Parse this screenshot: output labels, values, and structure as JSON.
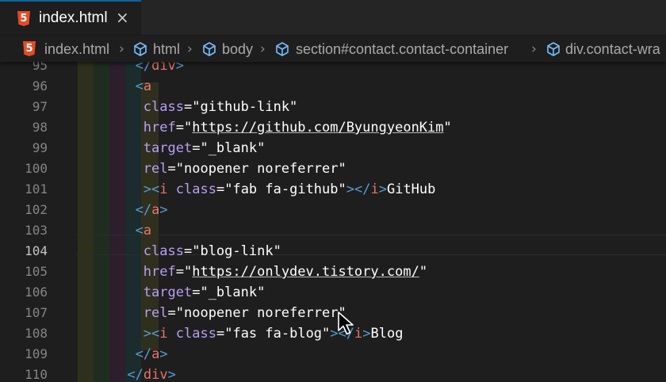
{
  "tab": {
    "label": "index.html",
    "close": "×",
    "icon": "html5-icon"
  },
  "breadcrumb": [
    {
      "label": "index.html",
      "icon": "html5-icon"
    },
    {
      "label": "html",
      "icon": "cube-icon"
    },
    {
      "label": "body",
      "icon": "cube-icon"
    },
    {
      "label": "section#contact.contact-container",
      "icon": "cube-icon"
    },
    {
      "label": "div.contact-wra",
      "icon": "cube-icon"
    }
  ],
  "editor": {
    "active_line": "104",
    "lines": [
      {
        "num": "95",
        "indent": "      ",
        "tokens": [
          [
            "tag",
            "</"
          ],
          [
            "tname",
            "div"
          ],
          [
            "tag",
            ">"
          ]
        ]
      },
      {
        "num": "96",
        "indent": "      ",
        "tokens": [
          [
            "tag",
            "<"
          ],
          [
            "tname",
            "a"
          ]
        ]
      },
      {
        "num": "97",
        "indent": "        ",
        "tokens": [
          [
            "attr",
            "class"
          ],
          [
            "str",
            "="
          ],
          [
            "str",
            "\"github-link\""
          ]
        ]
      },
      {
        "num": "98",
        "indent": "        ",
        "tokens": [
          [
            "attr",
            "href"
          ],
          [
            "str",
            "=\""
          ],
          [
            "link",
            "https://github.com/ByungyeonKim"
          ],
          [
            "str",
            "\""
          ]
        ]
      },
      {
        "num": "99",
        "indent": "        ",
        "tokens": [
          [
            "attr",
            "target"
          ],
          [
            "str",
            "=\"_blank\""
          ]
        ]
      },
      {
        "num": "100",
        "indent": "        ",
        "tokens": [
          [
            "attr",
            "rel"
          ],
          [
            "str",
            "=\"noopener noreferrer\""
          ]
        ]
      },
      {
        "num": "101",
        "indent": "        ",
        "tokens": [
          [
            "tag",
            ">"
          ],
          [
            "tag",
            "<"
          ],
          [
            "tname",
            "i"
          ],
          [
            "plain",
            " "
          ],
          [
            "attr",
            "class"
          ],
          [
            "str",
            "=\"fab fa-github\""
          ],
          [
            "tag",
            "></"
          ],
          [
            "tname",
            "i"
          ],
          [
            "tag",
            ">"
          ],
          [
            "str",
            "GitHub"
          ]
        ]
      },
      {
        "num": "102",
        "indent": "      ",
        "tokens": [
          [
            "tag",
            "</"
          ],
          [
            "tname",
            "a"
          ],
          [
            "tag",
            ">"
          ]
        ]
      },
      {
        "num": "103",
        "indent": "      ",
        "tokens": [
          [
            "tag",
            "<"
          ],
          [
            "tname",
            "a"
          ]
        ]
      },
      {
        "num": "104",
        "indent": "        ",
        "tokens": [
          [
            "attr",
            "class"
          ],
          [
            "str",
            "=\"blog-link\""
          ]
        ]
      },
      {
        "num": "105",
        "indent": "        ",
        "tokens": [
          [
            "attr",
            "href"
          ],
          [
            "str",
            "=\""
          ],
          [
            "link",
            "https://onlydev.tistory.com/"
          ],
          [
            "str",
            "\""
          ]
        ]
      },
      {
        "num": "106",
        "indent": "        ",
        "tokens": [
          [
            "attr",
            "target"
          ],
          [
            "str",
            "=\"_blank\""
          ]
        ]
      },
      {
        "num": "107",
        "indent": "        ",
        "tokens": [
          [
            "attr",
            "rel"
          ],
          [
            "str",
            "=\"noopener noreferrer\""
          ]
        ]
      },
      {
        "num": "108",
        "indent": "        ",
        "tokens": [
          [
            "tag",
            ">"
          ],
          [
            "tag",
            "<"
          ],
          [
            "tname",
            "i"
          ],
          [
            "plain",
            " "
          ],
          [
            "attr",
            "class"
          ],
          [
            "str",
            "=\"fas fa-blog\""
          ],
          [
            "tag",
            "></"
          ],
          [
            "tname",
            "i"
          ],
          [
            "tag",
            ">"
          ],
          [
            "str",
            "Blog"
          ]
        ]
      },
      {
        "num": "109",
        "indent": "      ",
        "tokens": [
          [
            "tag",
            "</"
          ],
          [
            "tname",
            "a"
          ],
          [
            "tag",
            ">"
          ]
        ]
      },
      {
        "num": "110",
        "indent": "    ",
        "tokens": [
          [
            "tag",
            "</"
          ],
          [
            "tname",
            "div"
          ],
          [
            "tag",
            ">"
          ]
        ]
      }
    ]
  },
  "colors": {
    "tag": "#569cd6",
    "tag_name": "#e8746b",
    "attribute": "#ba9ef6",
    "string": "#ffffff",
    "line_number": "#858585"
  }
}
